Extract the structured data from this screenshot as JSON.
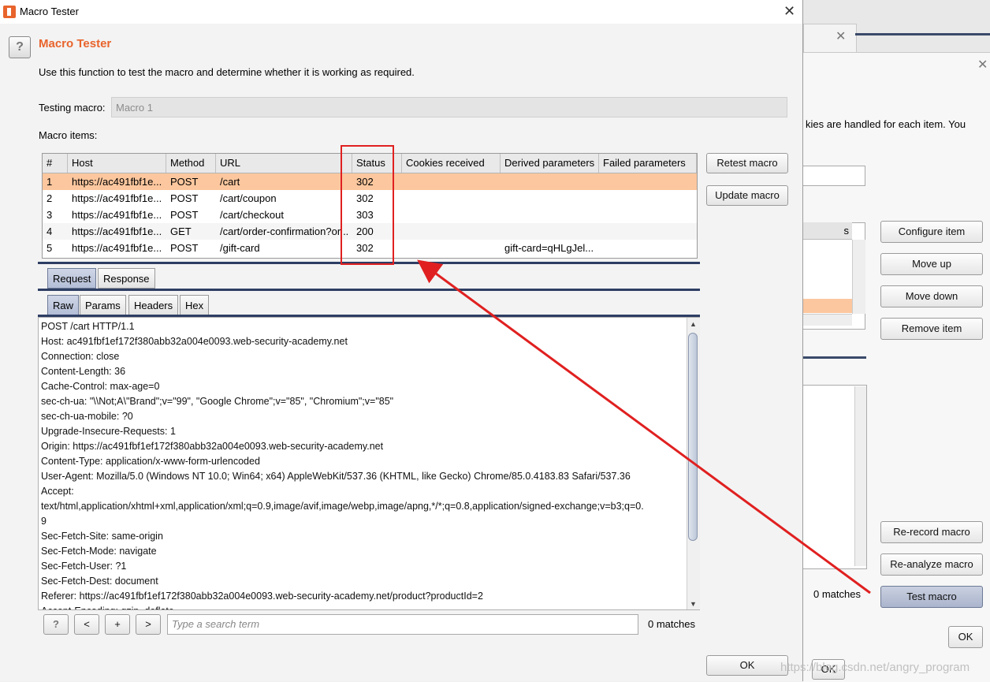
{
  "background": {
    "description_fragment": "kies are handled for each item. You",
    "table_header_fragment": "s",
    "buttons": {
      "configure": "Configure item",
      "move_up": "Move up",
      "move_down": "Move down",
      "remove": "Remove item",
      "rerecord": "Re-record macro",
      "reanalyze": "Re-analyze macro",
      "test": "Test macro",
      "ok": "OK",
      "ok2": "OK"
    },
    "matches": "0 matches"
  },
  "window": {
    "title": "Macro Tester",
    "close": "✕"
  },
  "heading": "Macro Tester",
  "intro": "Use this function to test the macro and determine whether it is working as required.",
  "testing_label": "Testing macro:",
  "testing_value": "Macro 1",
  "items_label": "Macro items:",
  "table": {
    "headers": [
      "#",
      "Host",
      "Method",
      "URL",
      "Status",
      "Cookies received",
      "Derived parameters",
      "Failed parameters"
    ],
    "rows": [
      {
        "n": "1",
        "host": "https://ac491fbf1e...",
        "method": "POST",
        "url": "/cart",
        "status": "302",
        "cookies": "",
        "derived": "",
        "failed": ""
      },
      {
        "n": "2",
        "host": "https://ac491fbf1e...",
        "method": "POST",
        "url": "/cart/coupon",
        "status": "302",
        "cookies": "",
        "derived": "",
        "failed": ""
      },
      {
        "n": "3",
        "host": "https://ac491fbf1e...",
        "method": "POST",
        "url": "/cart/checkout",
        "status": "303",
        "cookies": "",
        "derived": "",
        "failed": ""
      },
      {
        "n": "4",
        "host": "https://ac491fbf1e...",
        "method": "GET",
        "url": "/cart/order-confirmation?or...",
        "status": "200",
        "cookies": "",
        "derived": "",
        "failed": ""
      },
      {
        "n": "5",
        "host": "https://ac491fbf1e...",
        "method": "POST",
        "url": "/gift-card",
        "status": "302",
        "cookies": "",
        "derived": "gift-card=qHLgJel...",
        "failed": ""
      }
    ]
  },
  "buttons": {
    "retest": "Retest macro",
    "update": "Update macro",
    "ok": "OK"
  },
  "tabs_top": [
    "Request",
    "Response"
  ],
  "tabs_sub": [
    "Raw",
    "Params",
    "Headers",
    "Hex"
  ],
  "request_lines": [
    "POST /cart HTTP/1.1",
    "Host: ac491fbf1ef172f380abb32a004e0093.web-security-academy.net",
    "Connection: close",
    "Content-Length: 36",
    "Cache-Control: max-age=0",
    "sec-ch-ua: \"\\\\Not;A\\\"Brand\";v=\"99\", \"Google Chrome\";v=\"85\", \"Chromium\";v=\"85\"",
    "sec-ch-ua-mobile: ?0",
    "Upgrade-Insecure-Requests: 1",
    "Origin: https://ac491fbf1ef172f380abb32a004e0093.web-security-academy.net",
    "Content-Type: application/x-www-form-urlencoded",
    "User-Agent: Mozilla/5.0 (Windows NT 10.0; Win64; x64) AppleWebKit/537.36 (KHTML, like Gecko) Chrome/85.0.4183.83 Safari/537.36",
    "Accept:",
    "text/html,application/xhtml+xml,application/xml;q=0.9,image/avif,image/webp,image/apng,*/*;q=0.8,application/signed-exchange;v=b3;q=0.",
    "9",
    "Sec-Fetch-Site: same-origin",
    "Sec-Fetch-Mode: navigate",
    "Sec-Fetch-User: ?1",
    "Sec-Fetch-Dest: document",
    "Referer: https://ac491fbf1ef172f380abb32a004e0093.web-security-academy.net/product?productId=2",
    "Accept-Encoding: gzip, deflate"
  ],
  "search": {
    "help": "?",
    "prev": "<",
    "add": "+",
    "next": ">",
    "placeholder": "Type a search term",
    "matches": "0 matches"
  },
  "watermark": "https://blog.csdn.net/angry_program",
  "colors": {
    "accent": "#e8642c",
    "selected_row": "#fcc79e",
    "annotation": "#e02020"
  }
}
